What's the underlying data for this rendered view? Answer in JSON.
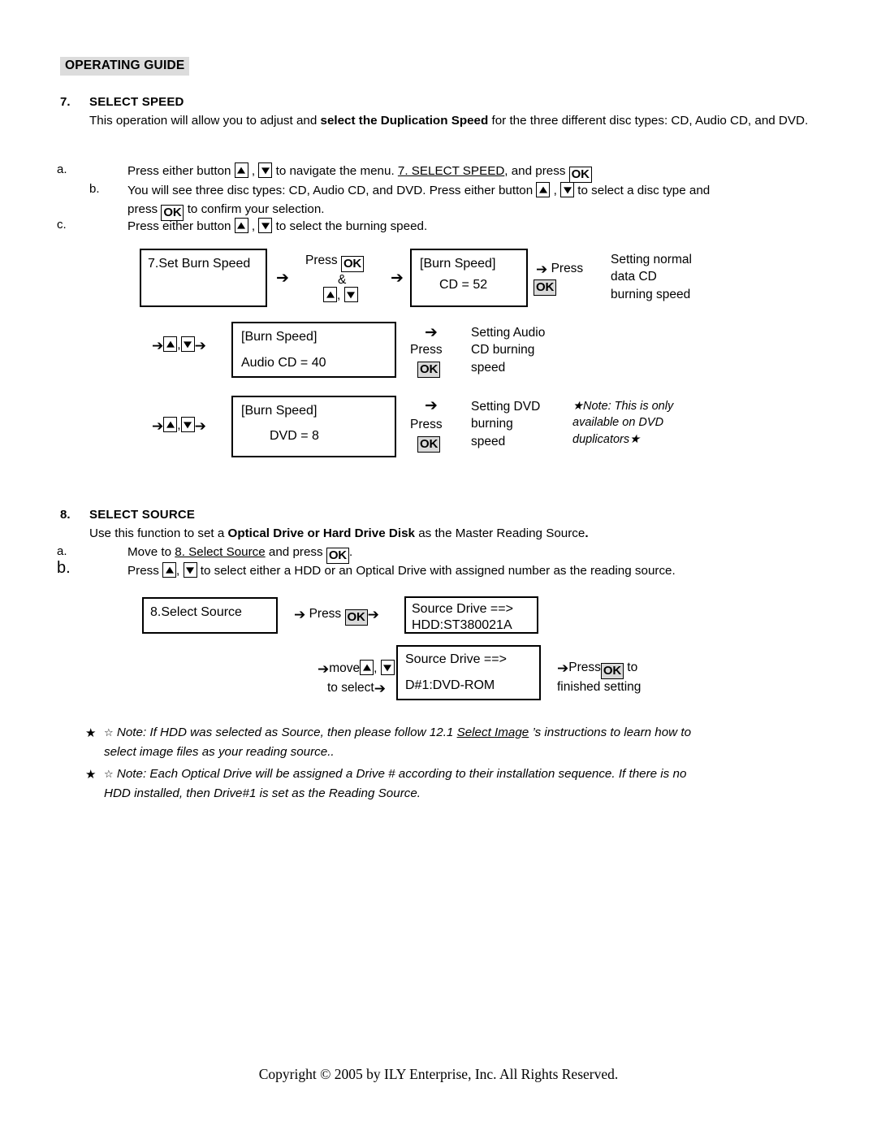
{
  "header": {
    "title": "OPERATING GUIDE"
  },
  "sections": [
    {
      "number": "7.",
      "title": "SELECT SPEED",
      "intro_a": "This operation will allow you to adjust and ",
      "intro_b": "select the Duplication Speed",
      "intro_c": " for the three different disc types: CD, Audio CD, and DVD.",
      "steps": [
        {
          "mark": "a.",
          "t1": "Press either button ",
          "t2": " , ",
          "t3": " to navigate the menu. ",
          "t4": "7. SELECT SPEED",
          "t5": ", and press ",
          "ok": "OK"
        },
        {
          "mark": "b.",
          "t1": "You will see three disc types:  CD, Audio CD, and DVD. Press either button ",
          "t2": " , ",
          "t3": " to select a disc type and",
          "t4": "press ",
          "ok": "OK",
          "t5": " to confirm your selection."
        },
        {
          "mark": "c.",
          "t1": "Press either button ",
          "t2": " , ",
          "t3": " to select the burning speed."
        }
      ]
    },
    {
      "number": "8.",
      "title": "SELECT SOURCE",
      "intro_a": "Use this function to set a ",
      "intro_b": "Optical Drive or Hard Drive Disk",
      "intro_c": " as the Master Reading Source",
      "intro_d": ".",
      "steps": [
        {
          "mark": "a.",
          "t1": "Move to ",
          "t2": "8. Select Source",
          "t3": " and press ",
          "ok": "OK",
          "t4": "."
        },
        {
          "mark": "b.",
          "t1": "Press ",
          "t2": ", ",
          "t3": " to select either a HDD or an Optical Drive with assigned number as the reading source."
        }
      ]
    }
  ],
  "speed_flow": {
    "row1": {
      "box1_line1": "7.Set Burn Speed",
      "arrow1": "➔",
      "press_label": "Press",
      "ok": "OK",
      "amp": "&",
      "arrow2": "➔",
      "box2_line1": "[Burn Speed]",
      "box2_line2": "CD = 52",
      "arrow3": "➔",
      "press2_label": "Press",
      "ok2": "OK",
      "result": "Setting normal\ndata CD\nburning speed"
    },
    "row2": {
      "arrow_in": "➔",
      "arrow_out": "➔",
      "comma": ",",
      "box_line1": "[Burn Speed]",
      "box_line2": "Audio CD = 40",
      "arrow_right": "➔",
      "press_label": "Press",
      "ok": "OK",
      "result": "Setting Audio\nCD burning\nspeed"
    },
    "row3": {
      "arrow_in": "➔",
      "arrow_out": "➔",
      "comma": ",",
      "box_line1": "[Burn Speed]",
      "box_line2": "DVD = 8",
      "arrow_right": "➔",
      "press_label": "Press",
      "ok": "OK",
      "result": "Setting DVD\nburning\nspeed",
      "note": "★Note: This is only\navailable on DVD\nduplicators★"
    }
  },
  "source_flow": {
    "row1": {
      "box1_line1": "8.Select Source",
      "arrow1": "➔",
      "press_label": "Press",
      "ok": "OK",
      "arrow2": "➔",
      "box2_line1": "Source Drive ==>",
      "box2_line2": "HDD:ST380021A"
    },
    "row2": {
      "arrow1": "➔",
      "move_label": "move",
      "comma": ",",
      "to_select": "to select",
      "arrow2": "➔",
      "box_line1": "Source Drive ==>",
      "box_line2": "D#1:DVD-ROM",
      "arrow3": "➔",
      "press_label": "Press",
      "ok": "OK",
      "press_tail": " to",
      "finished": "finished setting"
    }
  },
  "notes": [
    {
      "star": "★",
      "open_star": "☆",
      "t1": " Note: If HDD was selected as Source, then please follow 12.1 ",
      "t2": "Select Image",
      "t3": " ’s instructions to learn how  to",
      "t4": "select image files as your reading source.."
    },
    {
      "star": "★",
      "open_star": "☆",
      "t1": " Note: Each Optical Drive will be assigned a Drive # according to their installation sequence. If there is no",
      "t4": "HDD installed, then Drive#1 is set as the Reading Source."
    }
  ],
  "footer": {
    "copyright": "Copyright © 2005 by ILY Enterprise, Inc. All Rights Reserved."
  }
}
